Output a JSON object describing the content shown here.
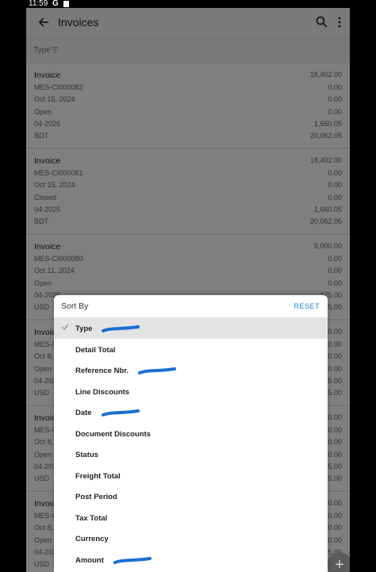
{
  "status_bar": {
    "time": "11:59",
    "icons": [
      "google-g-icon",
      "notification-icon"
    ]
  },
  "appbar": {
    "title": "Invoices",
    "back_icon": "arrow-left-icon",
    "search_icon": "search-icon",
    "menu_icon": "more-vert-icon"
  },
  "filter": {
    "label": "Type",
    "icon": "filter-icon"
  },
  "invoices": [
    {
      "type": "Invoice",
      "ref": "MES-CI000082",
      "date": "Oct 15, 2024",
      "status": "Open",
      "period": "04-2025",
      "currency": "BDT",
      "amounts": [
        "18,402.00",
        "0.00",
        "0.00",
        "0.00",
        "1,660.05",
        "20,062.05"
      ]
    },
    {
      "type": "Invoice",
      "ref": "MES-CI000081",
      "date": "Oct 15, 2024",
      "status": "Closed",
      "period": "04-2025",
      "currency": "BDT",
      "amounts": [
        "18,402.00",
        "0.00",
        "0.00",
        "0.00",
        "1,660.05",
        "20,062.05"
      ]
    },
    {
      "type": "Invoice",
      "ref": "MES-CI000080",
      "date": "Oct 11, 2024",
      "status": "Open",
      "period": "04-2025",
      "currency": "USD",
      "amounts": [
        "5,000.00",
        "0.00",
        "0.00",
        "0.00",
        "375.00",
        "5,375.00"
      ]
    },
    {
      "type": "Invoice",
      "ref": "MES-CI000079",
      "date": "Oct 8, 2024",
      "status": "Open",
      "period": "04-2025",
      "currency": "USD",
      "amounts": [
        "5,000.00",
        "0.00",
        "0.00",
        "0.00",
        "375.00",
        "5,375.00"
      ]
    },
    {
      "type": "Invoice",
      "ref": "MES-CI000078",
      "date": "Oct 8, 2024",
      "status": "Open",
      "period": "04-2025",
      "currency": "USD",
      "amounts": [
        "5,000.00",
        "0.00",
        "0.00",
        "0.00",
        "375.00",
        "5,375.00"
      ]
    },
    {
      "type": "Invoice",
      "ref": "MES-CI000077",
      "date": "Oct 8, 2024",
      "status": "Open",
      "period": "04-2025",
      "currency": "USD",
      "amounts": [
        "5,000.00",
        "0.00",
        "0.00",
        "0.00",
        "375.00",
        "5,375.00"
      ]
    }
  ],
  "sort_sheet": {
    "title": "Sort By",
    "reset_label": "RESET",
    "selected_index": 0,
    "options": [
      "Type",
      "Detail Total",
      "Reference Nbr.",
      "Line Discounts",
      "Date",
      "Document Discounts",
      "Status",
      "Freight Total",
      "Post Period",
      "Tax Total",
      "Currency",
      "Amount"
    ],
    "scribbled_options": [
      0,
      2,
      4,
      11
    ],
    "scribble_color": "#1b6fd1"
  },
  "fab": {
    "label": "+"
  },
  "colors": {
    "accent": "#1b7fd1",
    "overlay": "rgba(0,0,0,0.5)"
  }
}
